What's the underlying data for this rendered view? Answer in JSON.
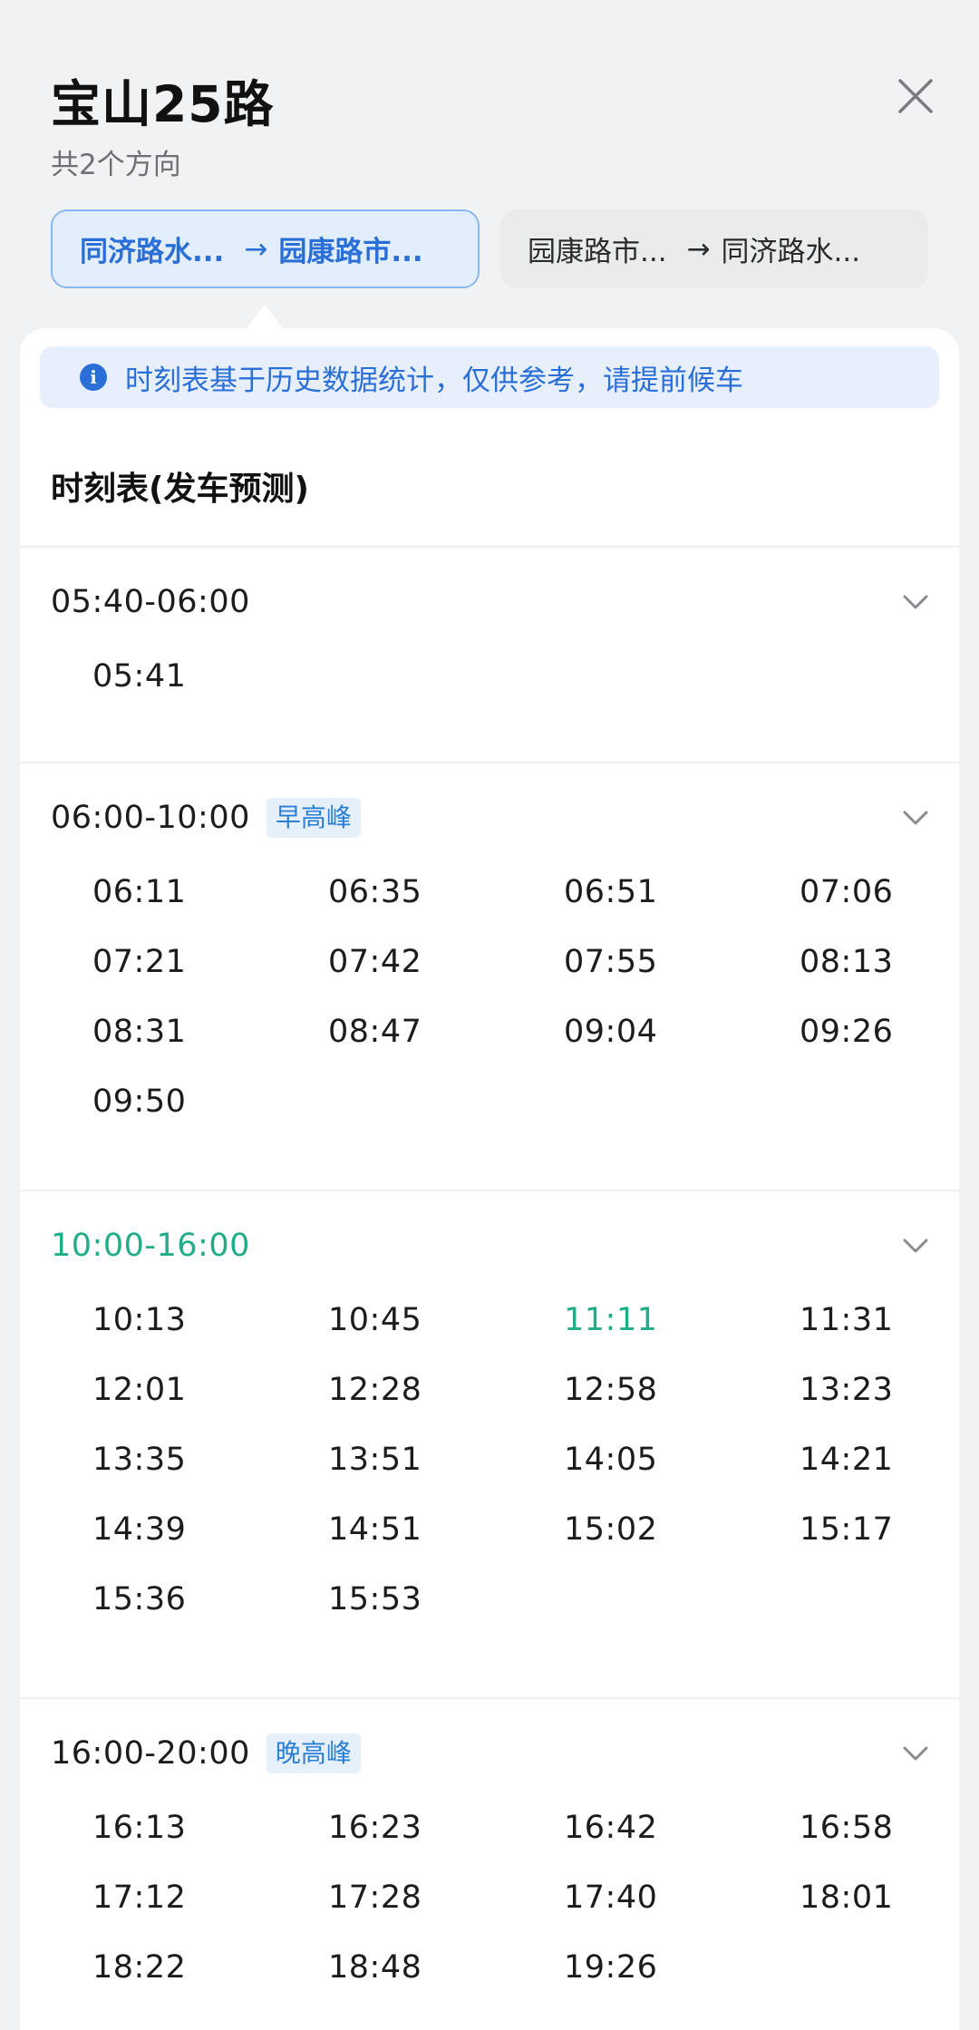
{
  "header": {
    "title": "宝山25路",
    "subtitle": "共2个方向"
  },
  "directions": [
    {
      "from": "同济路水...",
      "arrow": "→",
      "to": "园康路市...",
      "active": true
    },
    {
      "from": "园康路市...",
      "arrow": "→",
      "to": "同济路水...",
      "active": false
    }
  ],
  "notice": {
    "icon": "info-icon",
    "text": "时刻表基于历史数据统计，仅供参考，请提前候车"
  },
  "section_title": "时刻表(发车预测)",
  "blocks": [
    {
      "range": "05:40-06:00",
      "tag": "",
      "times": [
        "05:41"
      ]
    },
    {
      "range": "06:00-10:00",
      "tag": "早高峰",
      "times": [
        "06:11",
        "06:35",
        "06:51",
        "07:06",
        "07:21",
        "07:42",
        "07:55",
        "08:13",
        "08:31",
        "08:47",
        "09:04",
        "09:26",
        "09:50"
      ]
    },
    {
      "range": "10:00-16:00",
      "tag": "",
      "current": true,
      "times": [
        "10:13",
        "10:45",
        "11:11",
        "11:31",
        "12:01",
        "12:28",
        "12:58",
        "13:23",
        "13:35",
        "13:51",
        "14:05",
        "14:21",
        "14:39",
        "14:51",
        "15:02",
        "15:17",
        "15:36",
        "15:53"
      ],
      "next_time": "11:11"
    },
    {
      "range": "16:00-20:00",
      "tag": "晚高峰",
      "times": [
        "16:13",
        "16:23",
        "16:42",
        "16:58",
        "17:12",
        "17:28",
        "17:40",
        "18:01",
        "18:22",
        "18:48",
        "19:26"
      ]
    }
  ],
  "colors": {
    "accent_blue": "#2a6fd8",
    "current_green": "#22ad8a",
    "tag_blue": "#2a7fd4"
  }
}
